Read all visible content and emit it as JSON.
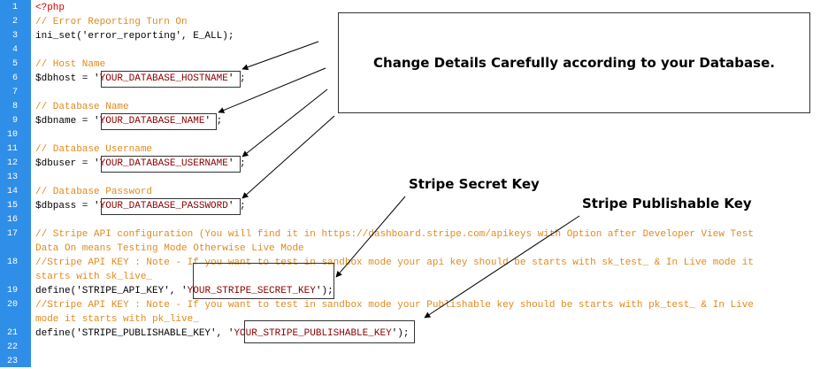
{
  "line_numbers": [
    "1",
    "2",
    "3",
    "4",
    "5",
    "6",
    "7",
    "8",
    "9",
    "10",
    "11",
    "12",
    "13",
    "14",
    "15",
    "16",
    "17",
    "",
    "18",
    "",
    "19",
    "20",
    "",
    "21",
    "22",
    "23"
  ],
  "code": {
    "l1": "<?php",
    "l2": "// Error Reporting Turn On",
    "l3": "ini_set('error_reporting', E_ALL);",
    "l5": "// Host Name",
    "l6_pre": "$dbhost = '",
    "l6_val": "YOUR_DATABASE_HOSTNAME",
    "l6_post": "' ;",
    "l8": "// Database Name",
    "l9_pre": "$dbname = '",
    "l9_val": "YOUR_DATABASE_NAME",
    "l9_post": "' ;",
    "l11": "// Database Username",
    "l12_pre": "$dbuser = '",
    "l12_val": "YOUR_DATABASE_USERNAME",
    "l12_post": "' ;",
    "l14": "// Database Password",
    "l15_pre": "$dbpass = '",
    "l15_val": "YOUR_DATABASE_PASSWORD",
    "l15_post": "' ;",
    "l17a": "// Stripe API configuration (You will find it in https://dashboard.stripe.com/apikeys with Option after Developer View Test",
    "l17b": "Data On means Testing Mode Otherwise Live Mode",
    "l18a": "//Stripe API KEY : Note - If you want to test in sandbox mode your api key should be starts with sk_test_ & In Live mode it",
    "l18b": "starts with sk_live_",
    "l19_pre": "define('STRIPE_API_KEY', '",
    "l19_val": "YOUR_STRIPE_SECRET_KEY",
    "l19_post": "');",
    "l20a": "//Stripe API KEY : Note - If you want to test in sandbox mode your Publishable key should be starts with pk_test_ & In Live",
    "l20b": "mode it starts with pk_live_",
    "l21_pre": "define('STRIPE_PUBLISHABLE_KEY', '",
    "l21_val": "YOUR_STRIPE_PUBLISHABLE_KEY",
    "l21_post": "');"
  },
  "annotations": {
    "callout": "Change Details Carefully according to your Database.",
    "secret_key_label": "Stripe Secret Key",
    "publishable_key_label": "Stripe Publishable Key"
  }
}
